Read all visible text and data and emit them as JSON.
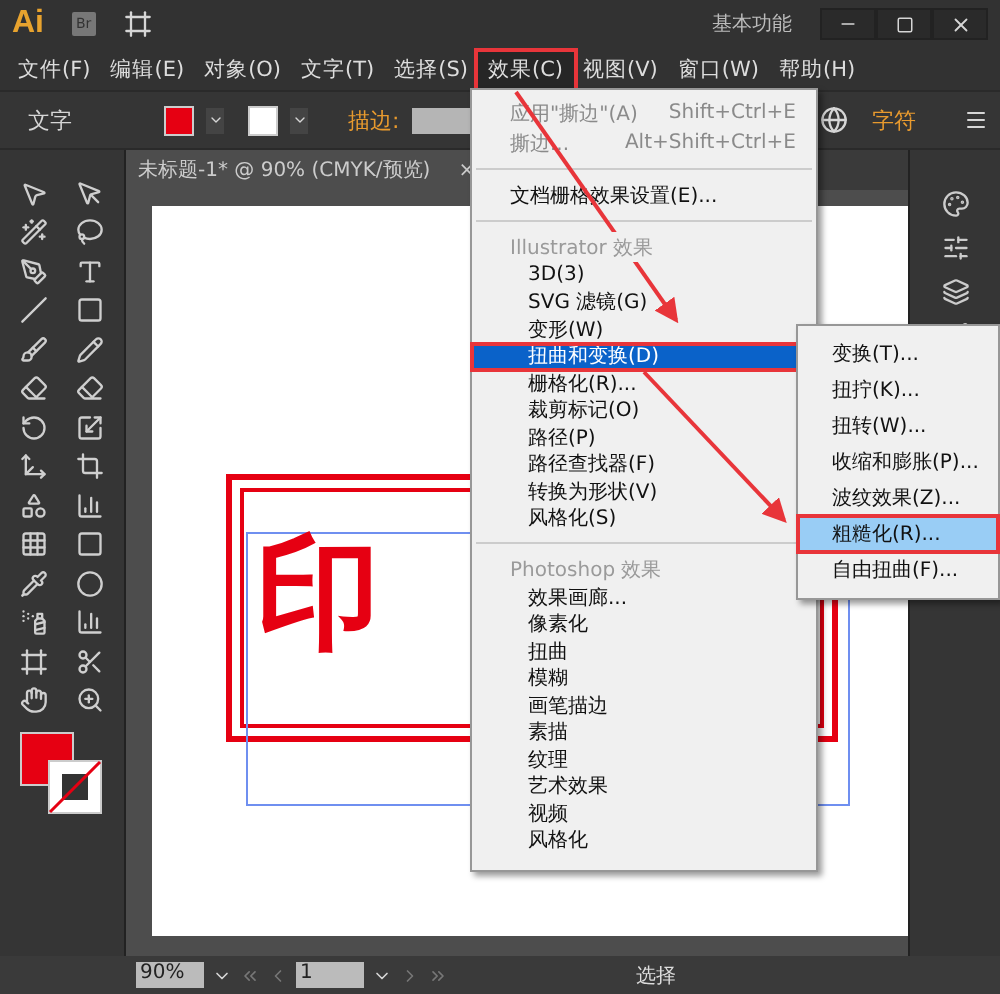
{
  "app": {
    "logo": "Ai",
    "bridge": "Br",
    "workspace": "基本功能"
  },
  "menubar": [
    {
      "label": "文件(F)",
      "selected": false,
      "annotated": false
    },
    {
      "label": "编辑(E)",
      "selected": false,
      "annotated": false
    },
    {
      "label": "对象(O)",
      "selected": false,
      "annotated": false
    },
    {
      "label": "文字(T)",
      "selected": false,
      "annotated": false
    },
    {
      "label": "选择(S)",
      "selected": false,
      "annotated": false
    },
    {
      "label": "效果(C)",
      "selected": true,
      "annotated": true
    },
    {
      "label": "视图(V)",
      "selected": false,
      "annotated": false
    },
    {
      "label": "窗口(W)",
      "selected": false,
      "annotated": false
    },
    {
      "label": "帮助(H)",
      "selected": false,
      "annotated": false
    }
  ],
  "control_bar": {
    "label": "文字",
    "stroke_label": "描边:",
    "panel_label": "字符"
  },
  "document_tab": {
    "title": "未标题-1* @ 90% (CMYK/预览)",
    "close": "×"
  },
  "artwork": {
    "text": "印"
  },
  "effect_menu": {
    "command_groups": [
      [
        {
          "label": "应用\"撕边\"(A)",
          "shortcut": "Shift+Ctrl+E",
          "disabled": true
        },
        {
          "label": "撕边...",
          "shortcut": "Alt+Shift+Ctrl+E",
          "disabled": true
        }
      ],
      [
        {
          "label": "文档栅格效果设置(E)...",
          "disabled": false
        }
      ]
    ],
    "sections": [
      {
        "header": "Illustrator 效果",
        "items": [
          {
            "label": "3D(3)",
            "selected": false,
            "annotated": false
          },
          {
            "label": "SVG 滤镜(G)",
            "selected": false,
            "annotated": false
          },
          {
            "label": "变形(W)",
            "selected": false,
            "annotated": false
          },
          {
            "label": "扭曲和变换(D)",
            "selected": true,
            "annotated": true
          },
          {
            "label": "栅格化(R)...",
            "selected": false,
            "annotated": false
          },
          {
            "label": "裁剪标记(O)",
            "selected": false,
            "annotated": false
          },
          {
            "label": "路径(P)",
            "selected": false,
            "annotated": false
          },
          {
            "label": "路径查找器(F)",
            "selected": false,
            "annotated": false
          },
          {
            "label": "转换为形状(V)",
            "selected": false,
            "annotated": false
          },
          {
            "label": "风格化(S)",
            "selected": false,
            "annotated": false
          }
        ]
      },
      {
        "header": "Photoshop 效果",
        "items": [
          {
            "label": "效果画廊...",
            "selected": false,
            "annotated": false
          },
          {
            "label": "像素化",
            "selected": false,
            "annotated": false
          },
          {
            "label": "扭曲",
            "selected": false,
            "annotated": false
          },
          {
            "label": "模糊",
            "selected": false,
            "annotated": false
          },
          {
            "label": "画笔描边",
            "selected": false,
            "annotated": false
          },
          {
            "label": "素描",
            "selected": false,
            "annotated": false
          },
          {
            "label": "纹理",
            "selected": false,
            "annotated": false
          },
          {
            "label": "艺术效果",
            "selected": false,
            "annotated": false
          },
          {
            "label": "视频",
            "selected": false,
            "annotated": false
          },
          {
            "label": "风格化",
            "selected": false,
            "annotated": false
          }
        ]
      }
    ]
  },
  "submenu": {
    "items": [
      {
        "label": "变换(T)...",
        "selected": false,
        "annotated": false
      },
      {
        "label": "扭拧(K)...",
        "selected": false,
        "annotated": false
      },
      {
        "label": "扭转(W)...",
        "selected": false,
        "annotated": false
      },
      {
        "label": "收缩和膨胀(P)...",
        "selected": false,
        "annotated": false
      },
      {
        "label": "波纹效果(Z)...",
        "selected": false,
        "annotated": false
      },
      {
        "label": "粗糙化(R)...",
        "selected": true,
        "annotated": true
      },
      {
        "label": "自由扭曲(F)...",
        "selected": false,
        "annotated": false
      }
    ]
  },
  "status_bar": {
    "zoom": "90%",
    "page": "1",
    "tool": "选择"
  }
}
